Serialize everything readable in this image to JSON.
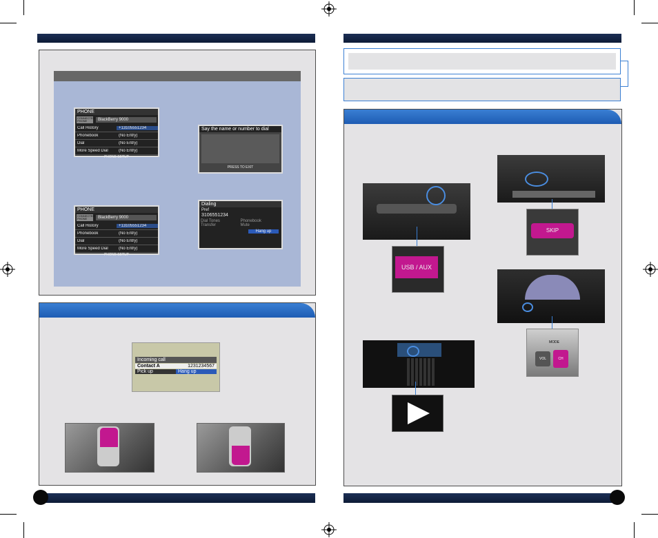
{
  "phone_screen_1": {
    "title": "PHONE",
    "connected_label": "CONNECTED PHONE",
    "device": "BlackBerry 9000",
    "menu": [
      "Call History",
      "Phonebook",
      "Dial",
      "More Speed Dial"
    ],
    "entries": [
      "+13105551234",
      "(No Entry)",
      "(No Entry)",
      "(No Entry)"
    ],
    "footer": "PHONE SETUP"
  },
  "phone_screen_2": {
    "title": "PHONE",
    "connected_label": "CONNECTED PHONE",
    "device": "BlackBerry 9000",
    "menu": [
      "Call History",
      "Phonebook",
      "Dial",
      "More Speed Dial"
    ],
    "entries": [
      "+13105551234",
      "(No Entry)",
      "(No Entry)",
      "(No Entry)"
    ],
    "footer": "PHONE SETUP"
  },
  "voice_screen": {
    "title": "Say the name or number to dial",
    "footer": "PRESS  TO EXIT"
  },
  "dialing_screen": {
    "title": "Dialing",
    "label": "Pref",
    "number": "3106551234",
    "options": [
      "Dial Tones",
      "Phonebook",
      "Transfer",
      "Mute"
    ],
    "hangup": "Hang up"
  },
  "incoming_call": {
    "title": "Incoming call",
    "contact": "Contact A",
    "number": "1231234567",
    "pickup": "Pick up",
    "hangup": "Hang up"
  },
  "usb_button": {
    "label": "USB / AUX"
  },
  "skip_button": {
    "label": "SKIP"
  },
  "wheel_switch": {
    "mode": "MODE",
    "vol": "VOL",
    "ch": "CH"
  },
  "colors": {
    "header_navy": "#12244a",
    "tab_blue": "#2a6fc8",
    "card_blue": "#a9b7d6",
    "magenta": "#c2188f"
  }
}
